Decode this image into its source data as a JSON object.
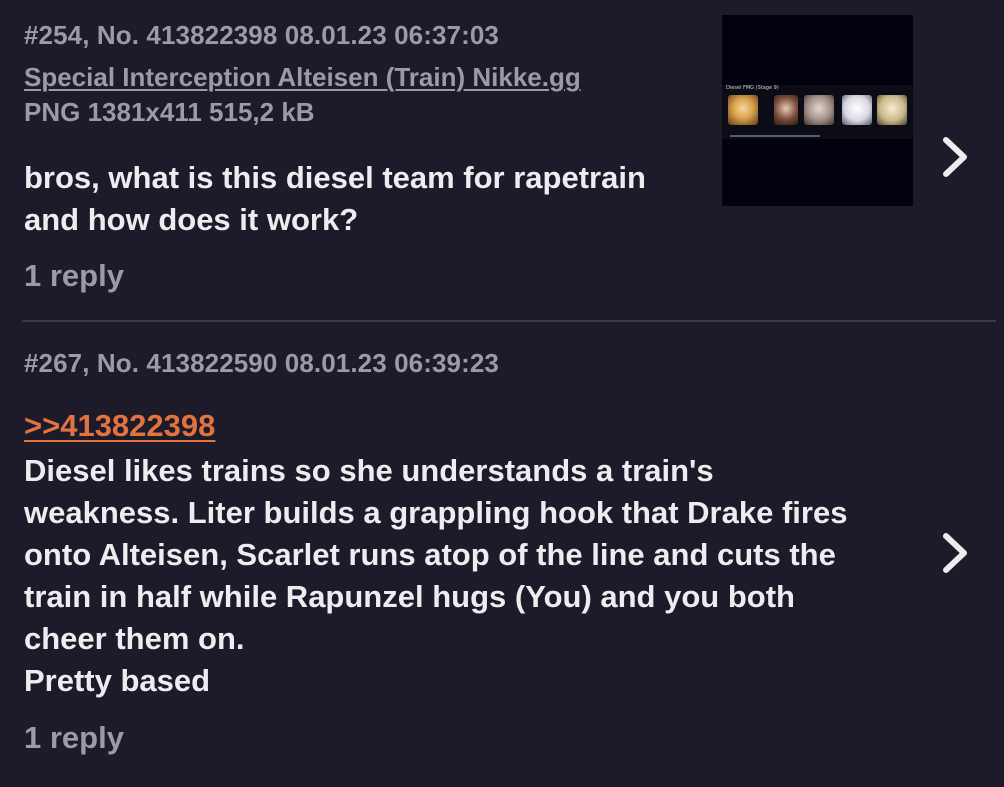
{
  "posts": [
    {
      "meta": "#254, No. 413822398 08.01.23 06:37:03",
      "file_name": "Special Interception Alteisen (Train) Nikke.gg",
      "file_info": "PNG 1381x411 515,2 kB",
      "thumbnail_title": "Diesel FMG (Stage 9)",
      "body": "bros, what is this diesel team for rapetrain\nand how does it work?",
      "replies": "1 reply",
      "chevron_icon": "chevron-right-icon"
    },
    {
      "meta": "#267, No. 413822590 08.01.23 06:39:23",
      "quote": ">>413822398",
      "body": "Diesel likes trains so she understands a train's\nweakness. Liter builds a grappling hook that Drake fires\nonto Alteisen, Scarlet runs atop of the line and cuts the\ntrain in half while Rapunzel hugs (You) and you both\ncheer them on.\nPretty based",
      "replies": "1 reply",
      "chevron_icon": "chevron-right-icon"
    }
  ],
  "colors": {
    "background": "#1d1b29",
    "text": "#ededf0",
    "muted": "#9c9aa6",
    "quote_link": "#e0733f",
    "divider": "#3a3848"
  }
}
